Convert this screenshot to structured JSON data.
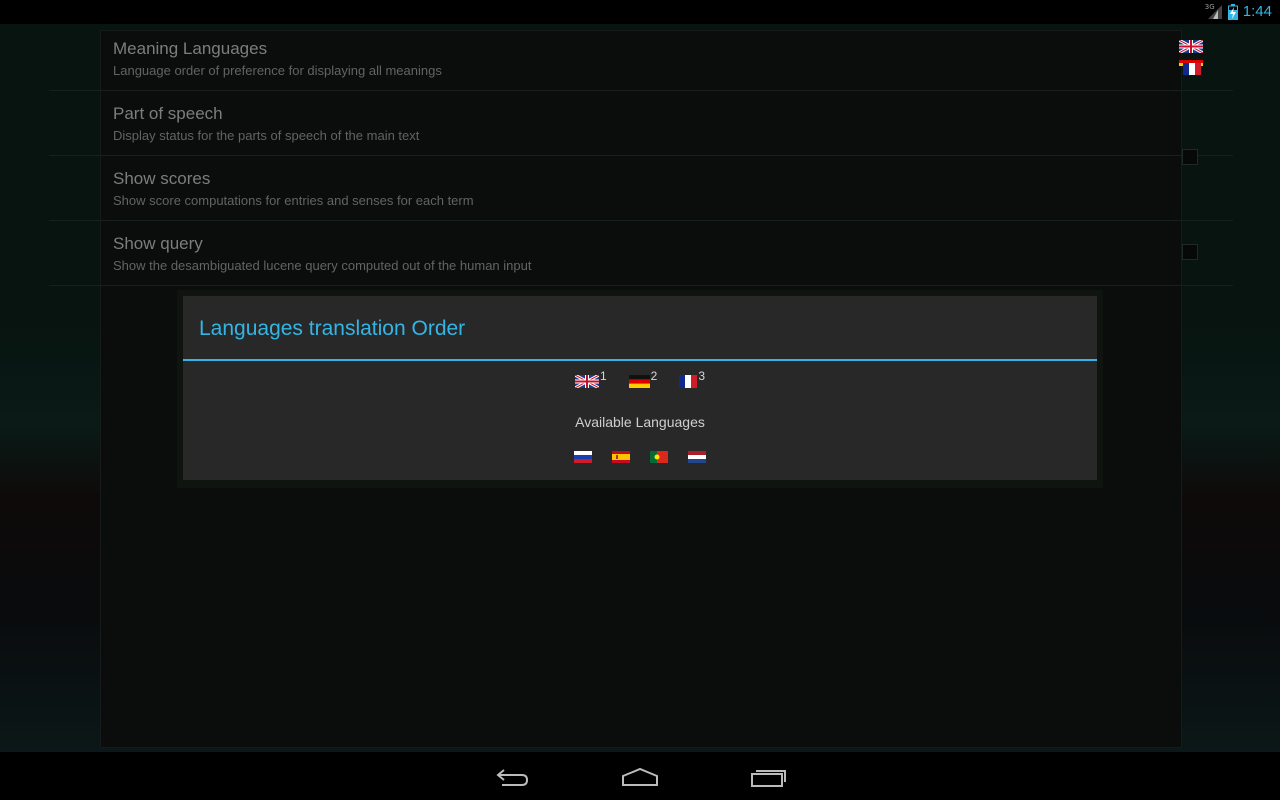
{
  "status_bar": {
    "network_label": "3G",
    "time": "1:44",
    "icons": [
      "signal-icon",
      "battery-charging-icon"
    ],
    "accent_color": "#33b5e5"
  },
  "preferences": [
    {
      "title": "Meaning Languages",
      "summary": "Language order of preference for displaying all meanings",
      "widget": "flags",
      "flags": [
        "gb",
        "de-fr"
      ]
    },
    {
      "title": "Part of speech",
      "summary": "Display status for the parts of speech of the main text",
      "widget": "none"
    },
    {
      "title": "Show scores",
      "summary": "Show score computations for entries and senses for each term",
      "widget": "checkbox",
      "checked": false
    },
    {
      "title": "Show query",
      "summary": "Show the desambiguated lucene query computed out of the human input",
      "widget": "checkbox",
      "checked": false
    }
  ],
  "dialog": {
    "title": "Languages translation Order",
    "ordered_languages": [
      {
        "flag": "gb",
        "order": "1"
      },
      {
        "flag": "de",
        "order": "2"
      },
      {
        "flag": "fr",
        "order": "3"
      }
    ],
    "available_label": "Available Languages",
    "available_languages": [
      {
        "flag": "ru"
      },
      {
        "flag": "es"
      },
      {
        "flag": "pt"
      },
      {
        "flag": "nl"
      }
    ],
    "accent_color": "#33b5e5"
  },
  "nav_bar": {
    "buttons": [
      "back-icon",
      "home-icon",
      "recent-apps-icon"
    ]
  }
}
